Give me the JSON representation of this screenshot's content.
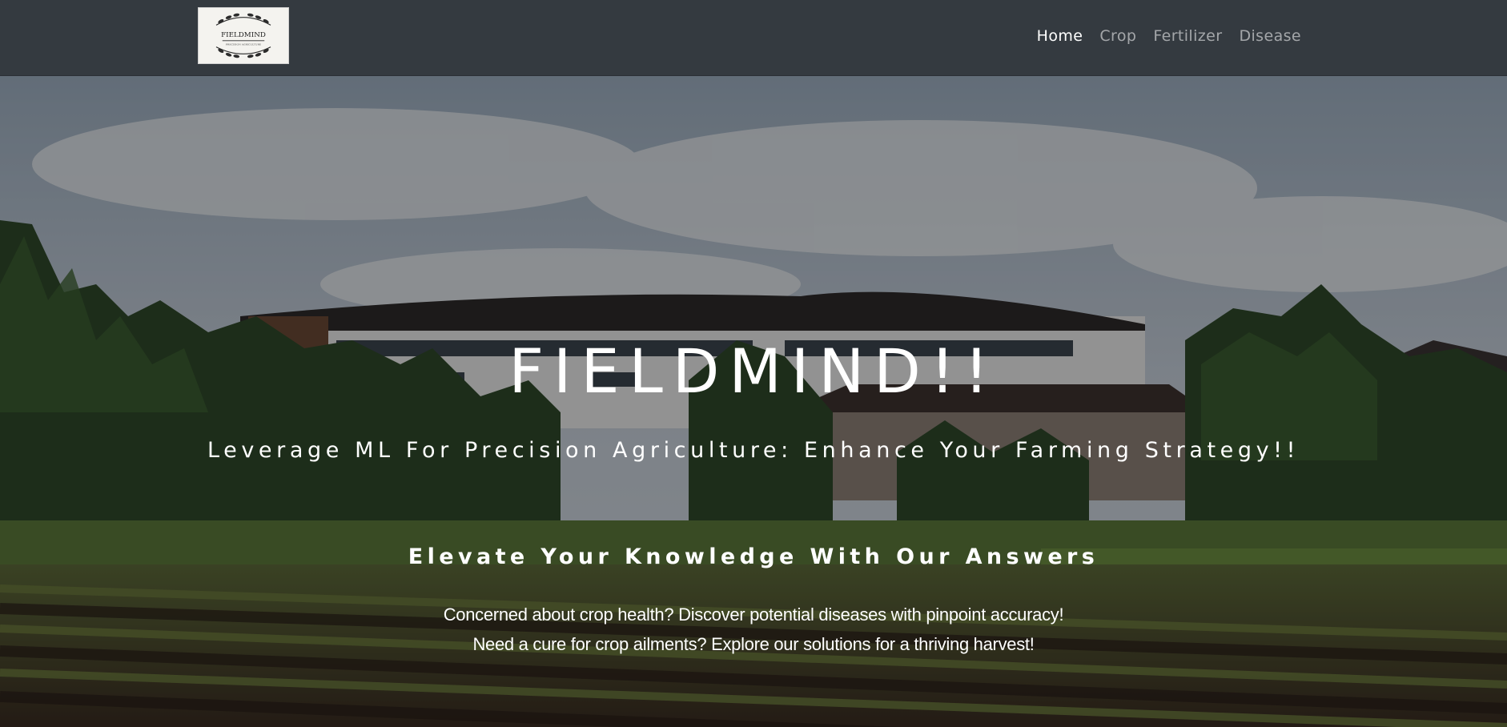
{
  "navbar": {
    "logo": {
      "text": "FIELDMIND",
      "subtext": "PRECISION AGRICULTURE",
      "icon": "wreath-icon"
    },
    "links": [
      {
        "label": "Home",
        "active": true
      },
      {
        "label": "Crop",
        "active": false
      },
      {
        "label": "Fertilizer",
        "active": false
      },
      {
        "label": "Disease",
        "active": false
      }
    ]
  },
  "hero": {
    "title": "FIELDMIND!!",
    "tagline": "Leverage ML For Precision Agriculture: Enhance Your Farming Strategy!!",
    "subheading": "Elevate Your Knowledge With Our Answers",
    "lines": [
      "Concerned about crop health? Discover potential diseases with pinpoint accuracy!",
      "Need a cure for crop ailments? Explore our solutions for a thriving harvest!"
    ],
    "background": "farm-field-photo"
  },
  "colors": {
    "navbar": "#343a40",
    "nav_active": "#ffffff",
    "nav_inactive": "rgba(255,255,255,0.55)",
    "hero_text": "#ffffff"
  }
}
